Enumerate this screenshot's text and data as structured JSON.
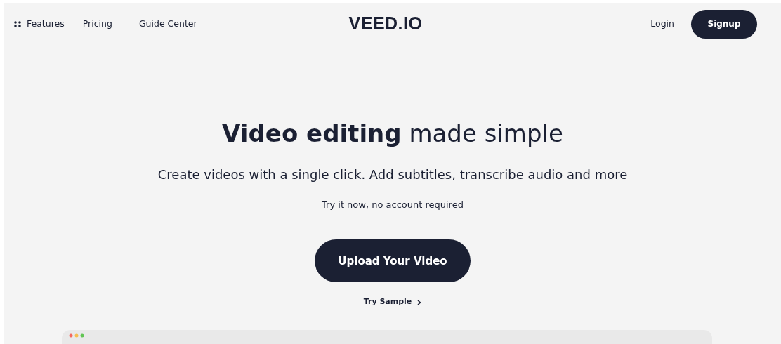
{
  "nav": {
    "links": [
      "Features",
      "Pricing",
      "Guide Center"
    ],
    "logo": "VEED.IO",
    "login": "Login",
    "signup": "Signup"
  },
  "hero": {
    "headline": "**Video editing** made simple",
    "subtitle": "Create videos with a single click. Add subtitles, transcribe audio and more",
    "note": "Try it now, no account required",
    "upload_button": "Upload Your Video",
    "sample_link": "Try Sample"
  }
}
